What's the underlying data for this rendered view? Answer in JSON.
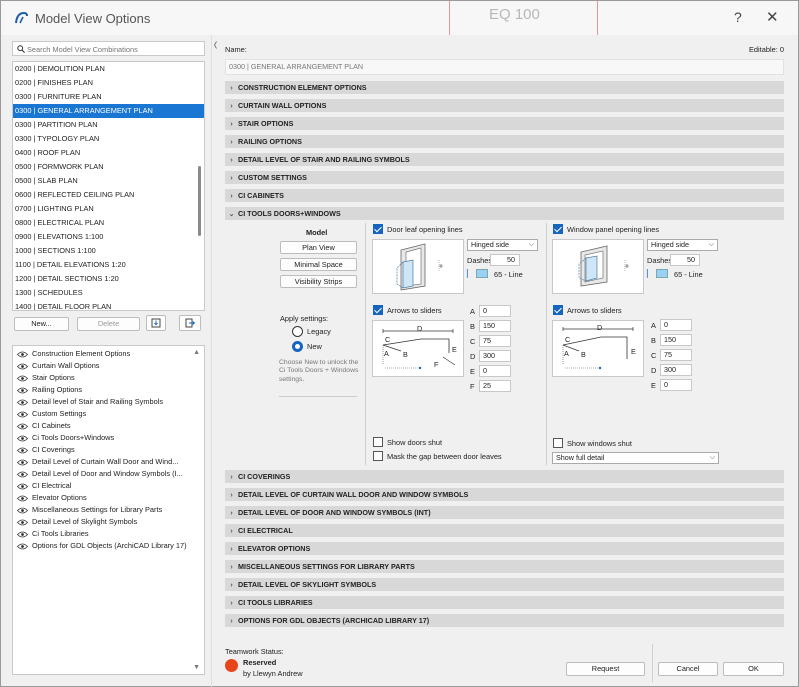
{
  "window": {
    "title": "Model View Options",
    "help": "?",
    "close": "✕",
    "bg_number": "EQ 100"
  },
  "search": {
    "placeholder": "Search Model View Combinations"
  },
  "combinations": [
    "0200 | DEMOLITION PLAN",
    "0200 | FINISHES PLAN",
    "0300 | FURNITURE PLAN",
    "0300 | GENERAL ARRANGEMENT PLAN",
    "0300 | PARTITION PLAN",
    "0300 | TYPOLOGY PLAN",
    "0400 | ROOF PLAN",
    "0500 | FORMWORK PLAN",
    "0500 | SLAB PLAN",
    "0600 | REFLECTED CEILING PLAN",
    "0700 | LIGHTING PLAN",
    "0800 | ELECTRICAL PLAN",
    "0900 | ELEVATIONS 1:100",
    "1000 | SECTIONS 1:100",
    "1100 | DETAIL ELEVATIONS 1:20",
    "1200 | DETAIL SECTIONS  1:20",
    "1300 | SCHEDULES",
    "1400 | DETAIL FLOOR PLAN"
  ],
  "selected_index": 3,
  "list_buttons": {
    "new": "New...",
    "delete": "Delete"
  },
  "options": [
    "Construction Element Options",
    "Curtain Wall Options",
    "Stair Options",
    "Railing Options",
    "Detail level of Stair and Railing Symbols",
    "Custom Settings",
    "CI Cabinets",
    "Ci Tools Doors+Windows",
    "CI Coverings",
    "Detail Level of Curtain Wall Door and Wind...",
    "Detail Level of Door and Window Symbols (I...",
    "CI Electrical",
    "Elevator Options",
    "Miscellaneous Settings for Library Parts",
    "Detail Level of Skylight Symbols",
    "Ci Tools Libraries",
    "Options for GDL Objects (ArchiCAD Library 17)"
  ],
  "header": {
    "name_label": "Name:",
    "editable": "Editable: 0",
    "name_value": "0300 | GENERAL ARRANGEMENT PLAN"
  },
  "sections_top": [
    "CONSTRUCTION ELEMENT OPTIONS",
    "CURTAIN WALL OPTIONS",
    "STAIR OPTIONS",
    "RAILING OPTIONS",
    "DETAIL LEVEL OF STAIR AND RAILING SYMBOLS",
    "CUSTOM SETTINGS",
    "CI CABINETS"
  ],
  "expanded_section": "CI TOOLS DOORS+WINDOWS",
  "sections_bottom": [
    "CI COVERINGS",
    "DETAIL LEVEL OF CURTAIN WALL DOOR AND WINDOW SYMBOLS",
    "DETAIL LEVEL OF DOOR AND WINDOW SYMBOLS (INT)",
    "CI ELECTRICAL",
    "ELEVATOR OPTIONS",
    "MISCELLANEOUS SETTINGS FOR LIBRARY PARTS",
    "DETAIL LEVEL OF SKYLIGHT SYMBOLS",
    "CI TOOLS LIBRARIES",
    "OPTIONS FOR GDL OBJECTS (ARCHICAD LIBRARY 17)"
  ],
  "model": {
    "title": "Model",
    "plan_view": "Plan View",
    "minimal_space": "Minimal Space",
    "visibility_strips": "Visibility Strips",
    "apply_label": "Apply settings:",
    "legacy": "Legacy",
    "new": "New",
    "hint": "Choose New to unlock the Ci Tools Doors + Windows settings."
  },
  "doors": {
    "opening_lines": "Door leaf opening lines",
    "hinge": "Hinged side",
    "dashes_label": "Dashes",
    "dashes": "50",
    "line": "65 - Line",
    "arrows": "Arrows to sliders",
    "params": [
      {
        "k": "A",
        "v": "0"
      },
      {
        "k": "B",
        "v": "150"
      },
      {
        "k": "C",
        "v": "75"
      },
      {
        "k": "D",
        "v": "300"
      },
      {
        "k": "E",
        "v": "0"
      },
      {
        "k": "F",
        "v": "25"
      }
    ],
    "show_shut": "Show doors shut",
    "mask_gap": "Mask the gap between door leaves"
  },
  "windows": {
    "opening_lines": "Window panel opening lines",
    "hinge": "Hinged side",
    "dashes_label": "Dashes",
    "dashes": "50",
    "line": "65 - Line",
    "arrows": "Arrows to sliders",
    "params": [
      {
        "k": "A",
        "v": "0"
      },
      {
        "k": "B",
        "v": "150"
      },
      {
        "k": "C",
        "v": "75"
      },
      {
        "k": "D",
        "v": "300"
      },
      {
        "k": "E",
        "v": "0"
      }
    ],
    "show_shut": "Show windows shut",
    "detail": "Show full detail"
  },
  "footer": {
    "team_label": "Teamwork Status:",
    "status": "Reserved",
    "by": "by Llewyn Andrew",
    "request": "Request",
    "cancel": "Cancel",
    "ok": "OK"
  },
  "colors": {
    "selection": "#1976d2",
    "status": "#e8451b",
    "accent": "#1565c0"
  }
}
